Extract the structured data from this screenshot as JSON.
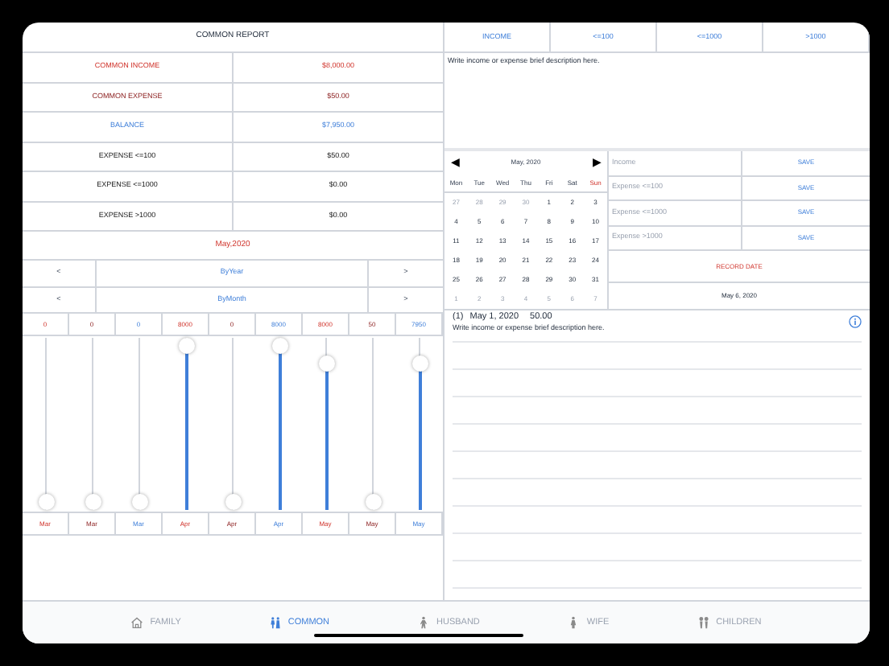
{
  "report": {
    "title": "COMMON REPORT",
    "rows": [
      {
        "label": "COMMON INCOME",
        "value": "$8,000.00",
        "kind": "income"
      },
      {
        "label": "COMMON EXPENSE",
        "value": "$50.00",
        "kind": "expense"
      },
      {
        "label": "BALANCE",
        "value": "$7,950.00",
        "kind": "balance"
      },
      {
        "label": "EXPENSE <=100",
        "value": "$50.00",
        "kind": "plain"
      },
      {
        "label": "EXPENSE <=1000",
        "value": "$0.00",
        "kind": "plain"
      },
      {
        "label": "EXPENSE >1000",
        "value": "$0.00",
        "kind": "plain"
      }
    ],
    "period": "May,2020",
    "navigators": [
      {
        "prev": "<",
        "label": "ByYear",
        "next": ">"
      },
      {
        "prev": "<",
        "label": "ByMonth",
        "next": ">"
      }
    ]
  },
  "sliders": [
    {
      "value": "0",
      "month": "Mar",
      "kind": "income",
      "level": 0
    },
    {
      "value": "0",
      "month": "Mar",
      "kind": "expense",
      "level": 0
    },
    {
      "value": "0",
      "month": "Mar",
      "kind": "balance",
      "level": 0
    },
    {
      "value": "8000",
      "month": "Apr",
      "kind": "income",
      "level": 1
    },
    {
      "value": "0",
      "month": "Apr",
      "kind": "expense",
      "level": 0
    },
    {
      "value": "8000",
      "month": "Apr",
      "kind": "balance",
      "level": 1
    },
    {
      "value": "8000",
      "month": "May",
      "kind": "income",
      "level": 0.89
    },
    {
      "value": "50",
      "month": "May",
      "kind": "expense",
      "level": 0
    },
    {
      "value": "7950",
      "month": "May",
      "kind": "balance",
      "level": 0.89
    }
  ],
  "category_tabs": [
    {
      "label": "INCOME",
      "selected": false
    },
    {
      "label": "<=100",
      "selected": false
    },
    {
      "label": "<=1000",
      "selected": false
    },
    {
      "label": ">1000",
      "selected": false
    }
  ],
  "description": {
    "placeholder": "Write income or expense brief description here."
  },
  "calendar": {
    "prev": "◀",
    "title": "May, 2020",
    "next": "▶",
    "weekdays": [
      {
        "label": "Mon",
        "weekend": false
      },
      {
        "label": "Tue",
        "weekend": false
      },
      {
        "label": "Wed",
        "weekend": false
      },
      {
        "label": "Thu",
        "weekend": false
      },
      {
        "label": "Fri",
        "weekend": false
      },
      {
        "label": "Sat",
        "weekend": false
      },
      {
        "label": "Sun",
        "weekend": true
      }
    ],
    "days": [
      {
        "label": "27",
        "faded": true
      },
      {
        "label": "28",
        "faded": true
      },
      {
        "label": "29",
        "faded": true
      },
      {
        "label": "30",
        "faded": true
      },
      {
        "label": "1",
        "faded": false
      },
      {
        "label": "2",
        "faded": false
      },
      {
        "label": "3",
        "faded": false
      },
      {
        "label": "4",
        "faded": false
      },
      {
        "label": "5",
        "faded": false
      },
      {
        "label": "6",
        "faded": false
      },
      {
        "label": "7",
        "faded": false
      },
      {
        "label": "8",
        "faded": false
      },
      {
        "label": "9",
        "faded": false
      },
      {
        "label": "10",
        "faded": false
      },
      {
        "label": "11",
        "faded": false
      },
      {
        "label": "12",
        "faded": false
      },
      {
        "label": "13",
        "faded": false
      },
      {
        "label": "14",
        "faded": false
      },
      {
        "label": "15",
        "faded": false
      },
      {
        "label": "16",
        "faded": false
      },
      {
        "label": "17",
        "faded": false
      },
      {
        "label": "18",
        "faded": false
      },
      {
        "label": "19",
        "faded": false
      },
      {
        "label": "20",
        "faded": false
      },
      {
        "label": "21",
        "faded": false
      },
      {
        "label": "22",
        "faded": false
      },
      {
        "label": "23",
        "faded": false
      },
      {
        "label": "24",
        "faded": false
      },
      {
        "label": "25",
        "faded": false
      },
      {
        "label": "26",
        "faded": false
      },
      {
        "label": "27",
        "faded": false
      },
      {
        "label": "28",
        "faded": false
      },
      {
        "label": "29",
        "faded": false
      },
      {
        "label": "30",
        "faded": false
      },
      {
        "label": "31",
        "faded": false
      },
      {
        "label": "1",
        "faded": true
      },
      {
        "label": "2",
        "faded": true
      },
      {
        "label": "3",
        "faded": true
      },
      {
        "label": "4",
        "faded": true
      },
      {
        "label": "5",
        "faded": true
      },
      {
        "label": "6",
        "faded": true
      },
      {
        "label": "7",
        "faded": true
      }
    ]
  },
  "amount_fields": [
    {
      "placeholder": "Income",
      "button": "SAVE"
    },
    {
      "placeholder": "Expense <=100",
      "button": "SAVE"
    },
    {
      "placeholder": "Expense <=1000",
      "button": "SAVE"
    },
    {
      "placeholder": "Expense >1000",
      "button": "SAVE"
    }
  ],
  "record_date": {
    "button": "RECORD DATE",
    "value": "May 6, 2020"
  },
  "entries": [
    {
      "index": "(1)",
      "date": "May 1, 2020",
      "amount": "50.00",
      "description": "Write income or expense brief description here."
    }
  ],
  "tab_bar": [
    {
      "label": "FAMILY",
      "selected": false
    },
    {
      "label": "COMMON",
      "selected": true
    },
    {
      "label": "HUSBAND",
      "selected": false
    },
    {
      "label": "WIFE",
      "selected": false
    },
    {
      "label": "CHILDREN",
      "selected": false
    }
  ]
}
